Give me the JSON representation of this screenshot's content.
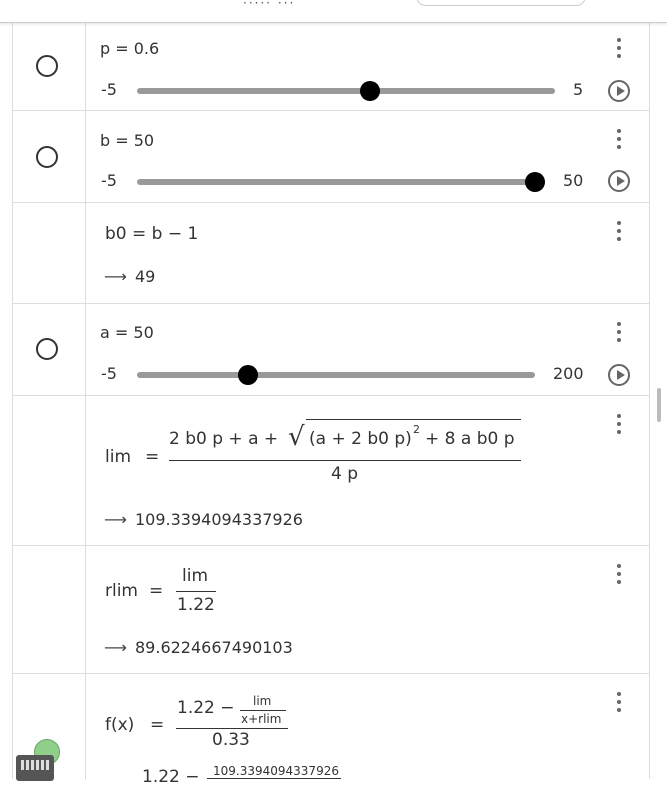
{
  "rows": [
    {
      "kind": "slider",
      "name": "p",
      "value": "0.6",
      "min": "-5",
      "max": "5",
      "level": 0.56
    },
    {
      "kind": "slider",
      "name": "b",
      "value": "50",
      "min": "-5",
      "max": "50",
      "level": 1.0
    },
    {
      "kind": "def",
      "lhs": "b0",
      "rhs": "b − 1",
      "result": "49"
    },
    {
      "kind": "slider",
      "name": "a",
      "value": "50",
      "min": "-5",
      "max": "200",
      "level": 0.27
    },
    {
      "kind": "frac",
      "lhs": "lim",
      "num_left": "2 b0 p + a +",
      "num_rad": "(a + 2 b0 p)",
      "num_exp": "2",
      "num_right": "+ 8 a b0 p",
      "den": "4 p",
      "result": "109.3394094337926"
    },
    {
      "kind": "frac",
      "lhs": "rlim",
      "num": "lim",
      "den": "1.22",
      "result": "89.6224667490103"
    },
    {
      "kind": "func",
      "lhs": "f(x)",
      "num_main": "1.22 −",
      "inner_num": "lim",
      "inner_den": "x+rlim",
      "den": "0.33",
      "next_left": "1.22 −",
      "next_inner": "109.3394094337926"
    }
  ],
  "ops": {
    "eq": "=",
    "arrow": "⟶",
    "sqrt": "√"
  }
}
